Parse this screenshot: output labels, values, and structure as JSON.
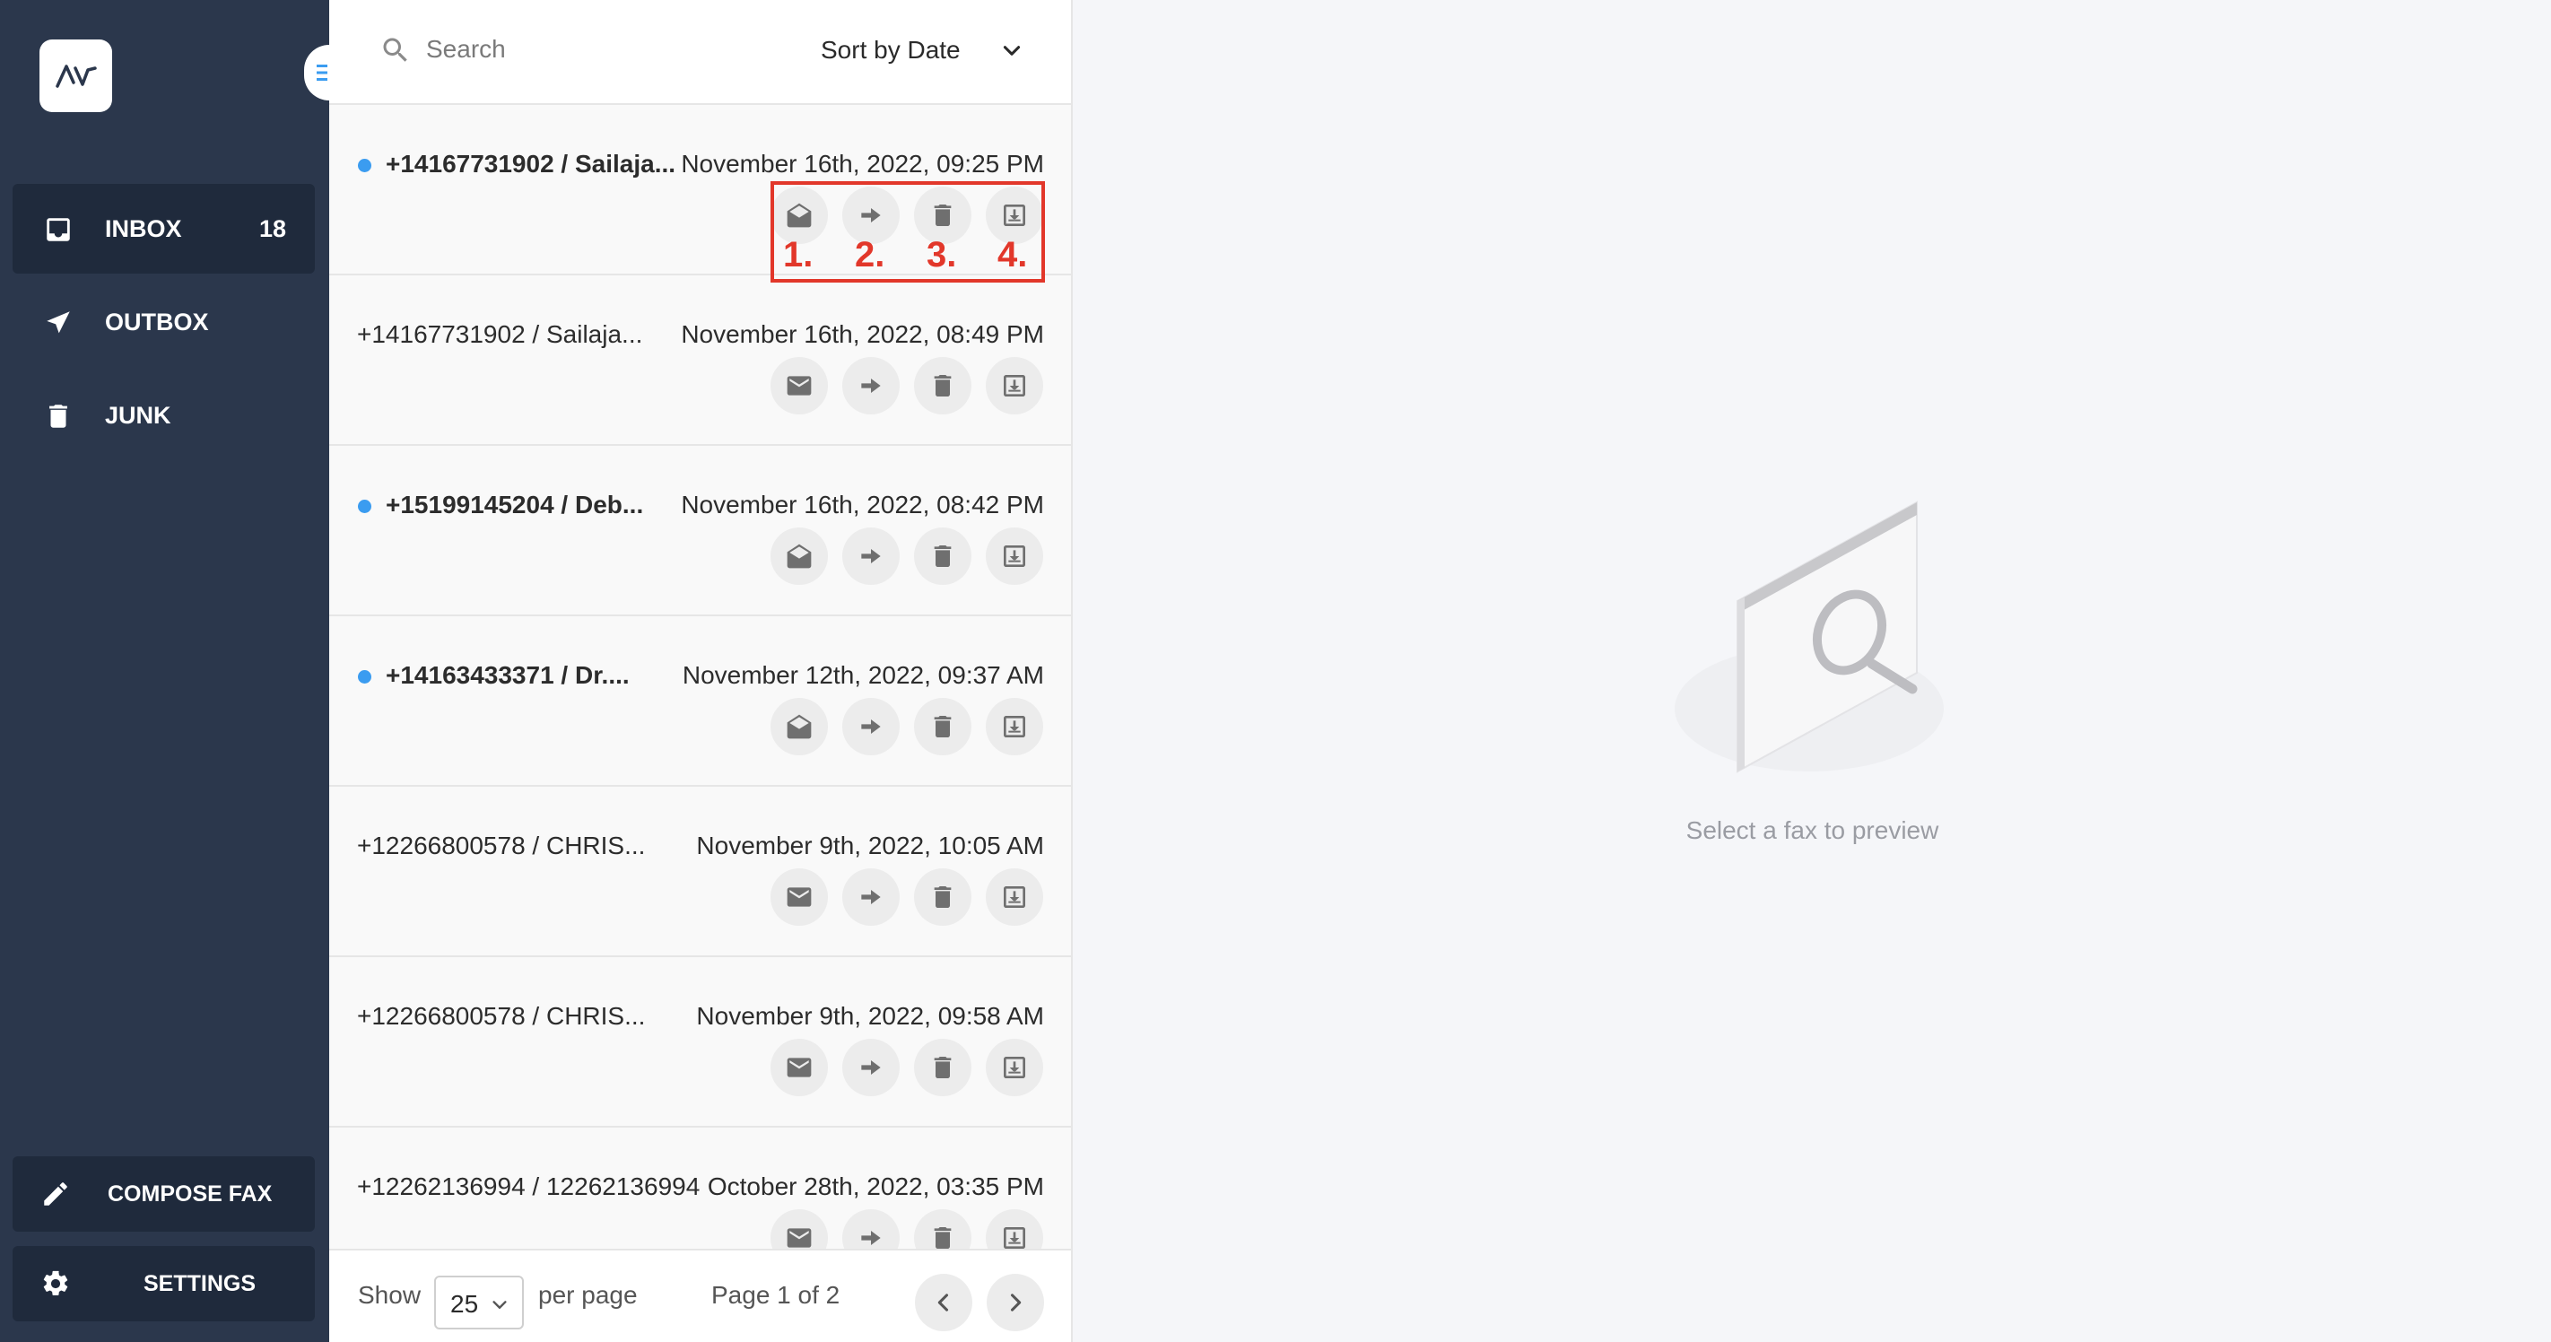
{
  "sidebar": {
    "logo_text": "AV",
    "nav": [
      {
        "label": "INBOX",
        "count": "18",
        "icon": "inbox-icon"
      },
      {
        "label": "OUTBOX",
        "icon": "send-icon"
      },
      {
        "label": "JUNK",
        "icon": "trash-icon"
      }
    ],
    "compose_label": "COMPOSE FAX",
    "settings_label": "SETTINGS"
  },
  "list": {
    "search_placeholder": "Search",
    "sort_label": "Sort by Date",
    "rows": [
      {
        "sender": "+14167731902 / Sailaja...",
        "date": "November 16th, 2022, 09:25 PM",
        "unread": true
      },
      {
        "sender": "+14167731902 / Sailaja...",
        "date": "November 16th, 2022, 08:49 PM",
        "unread": false
      },
      {
        "sender": "+15199145204 / Deb...",
        "date": "November 16th, 2022, 08:42 PM",
        "unread": true
      },
      {
        "sender": "+14163433371 / Dr....",
        "date": "November 12th, 2022, 09:37 AM",
        "unread": true
      },
      {
        "sender": "+12266800578 / CHRIS...",
        "date": "November 9th, 2022, 10:05 AM",
        "unread": false
      },
      {
        "sender": "+12266800578 / CHRIS...",
        "date": "November 9th, 2022, 09:58 AM",
        "unread": false
      },
      {
        "sender": "+12262136994 / 12262136994",
        "date": "October 28th, 2022, 03:35 PM",
        "unread": false
      }
    ],
    "annotations": [
      "1.",
      "2.",
      "3.",
      "4."
    ],
    "footer": {
      "show_label": "Show",
      "per_page_value": "25",
      "per_page_label": "per page",
      "page_info": "Page 1 of 2"
    }
  },
  "preview": {
    "hint": "Select a fax to preview"
  },
  "colors": {
    "sidebar_bg": "#2b374c",
    "sidebar_active": "#1f2a3c",
    "unread_dot": "#3b9cf0",
    "annotation_red": "#e2372a"
  }
}
